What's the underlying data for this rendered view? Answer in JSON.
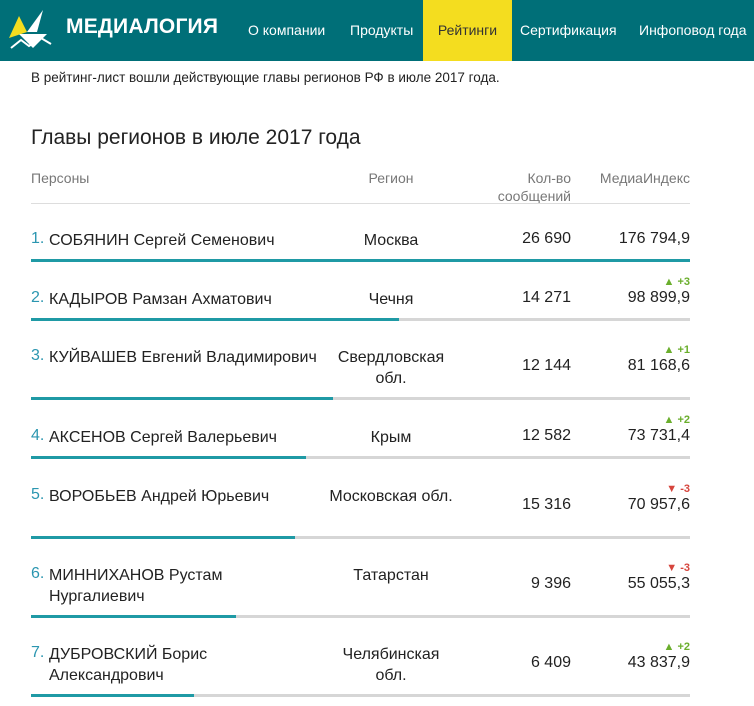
{
  "header": {
    "logo_text": "МЕДИАЛОГИЯ",
    "nav": [
      {
        "label": "О компании",
        "active": false
      },
      {
        "label": "Продукты",
        "active": false
      },
      {
        "label": "Рейтинги",
        "active": true
      },
      {
        "label": "Сертификация",
        "active": false
      },
      {
        "label": "Инфоповод года",
        "active": false
      }
    ]
  },
  "intro": "В рейтинг-лист вошли действующие главы регионов РФ в июле 2017 года.",
  "title": "Главы регионов в июле 2017 года",
  "columns": {
    "persons": "Персоны",
    "region": "Регион",
    "messages": "Кол-во сообщений",
    "index": "МедиаИндекс"
  },
  "colors": {
    "brand": "#006f78",
    "active_tab": "#f4dd1f",
    "bar": "#1f9aa5",
    "up": "#6aae2c",
    "down": "#d6453d"
  },
  "rows": [
    {
      "rank": "1.",
      "name": "СОБЯНИН Сергей Семенович",
      "region": "Москва",
      "messages": "26 690",
      "index": "176 794,9",
      "change": "",
      "dir": "",
      "bar_fraction": 1.0
    },
    {
      "rank": "2.",
      "name": "КАДЫРОВ Рамзан Ахматович",
      "region": "Чечня",
      "messages": "14 271",
      "index": "98 899,9",
      "change": "▲ +3",
      "dir": "up",
      "bar_fraction": 0.559
    },
    {
      "rank": "3.",
      "name": "КУЙВАШЕВ Евгений Владимирович",
      "region": "Свердловская обл.",
      "messages": "12 144",
      "index": "81 168,6",
      "change": "▲ +1",
      "dir": "up",
      "bar_fraction": 0.459
    },
    {
      "rank": "4.",
      "name": "АКСЕНОВ Сергей Валерьевич",
      "region": "Крым",
      "messages": "12 582",
      "index": "73 731,4",
      "change": "▲ +2",
      "dir": "up",
      "bar_fraction": 0.417
    },
    {
      "rank": "5.",
      "name": "ВОРОБЬЕВ Андрей Юрьевич",
      "region": "Московская обл.",
      "messages": "15 316",
      "index": "70 957,6",
      "change": "▼ -3",
      "dir": "down",
      "bar_fraction": 0.401
    },
    {
      "rank": "6.",
      "name": "МИННИХАНОВ Рустам Нургалиевич",
      "region": "Татарстан",
      "messages": "9 396",
      "index": "55 055,3",
      "change": "▼ -3",
      "dir": "down",
      "bar_fraction": 0.311
    },
    {
      "rank": "7.",
      "name": "ДУБРОВСКИЙ Борис Александрович",
      "region": "Челябинская обл.",
      "messages": "6 409",
      "index": "43 837,9",
      "change": "▲ +2",
      "dir": "up",
      "bar_fraction": 0.248
    }
  ]
}
